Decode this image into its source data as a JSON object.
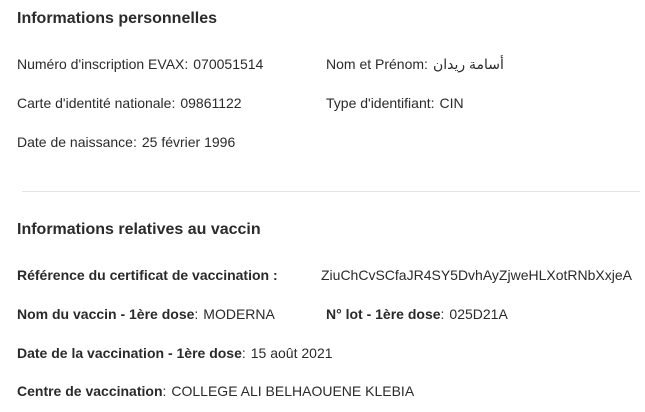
{
  "personal": {
    "title": "Informations personnelles",
    "evax": {
      "label": "Numéro d'inscription EVAX",
      "value": "070051514"
    },
    "name": {
      "label": "Nom et Prénom",
      "value": "أسامة ريدان"
    },
    "id_card": {
      "label": "Carte d'identité nationale",
      "value": "09861122"
    },
    "id_type": {
      "label": "Type d'identifiant",
      "value": "CIN"
    },
    "birth": {
      "label": "Date de naissance",
      "value": "25 février 1996"
    }
  },
  "vaccine": {
    "title": "Informations relatives au vaccin",
    "certificate": {
      "label": "Référence du certificat de vaccination :",
      "value": "ZiuChCvSCfaJR4SY5DvhAyZjweHLXotRNbXxjeA"
    },
    "vaccine_name": {
      "label": "Nom du vaccin - 1ère dose",
      "value": "MODERNA"
    },
    "lot": {
      "label": "N° lot - 1ère dose",
      "value": "025D21A"
    },
    "date": {
      "label": "Date de la vaccination - 1ère dose",
      "value": "15 août 2021"
    },
    "center": {
      "label": "Centre de vaccination",
      "value": "COLLEGE ALI BELHAOUENE KLEBIA"
    }
  },
  "separator": ":"
}
